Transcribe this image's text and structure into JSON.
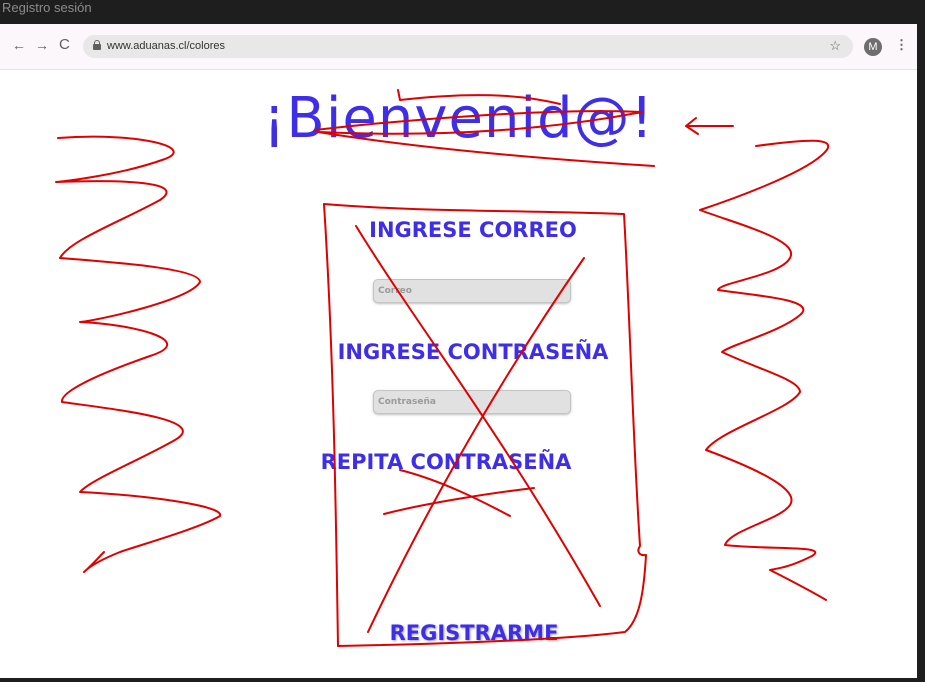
{
  "window": {
    "title": "Registro sesión"
  },
  "browser": {
    "url": "www.aduanas.cl/colores",
    "profile_initial": "M",
    "back_glyph": "←",
    "forward_glyph": "→",
    "reload_glyph": "C",
    "star_glyph": "☆",
    "menu_glyph": "⋮"
  },
  "page": {
    "heading": "¡Bienvenid@!",
    "email_label": "INGRESE CORREO",
    "email_placeholder": "Correo",
    "password_label": "INGRESE CONTRASEÑA",
    "password_placeholder": "Contraseña",
    "repeat_password_label": "REPITA CONTRASEÑA",
    "register_button": "REGISTRARME"
  },
  "colors": {
    "accent": "#3f2ee8",
    "annotation": "#e00000"
  }
}
